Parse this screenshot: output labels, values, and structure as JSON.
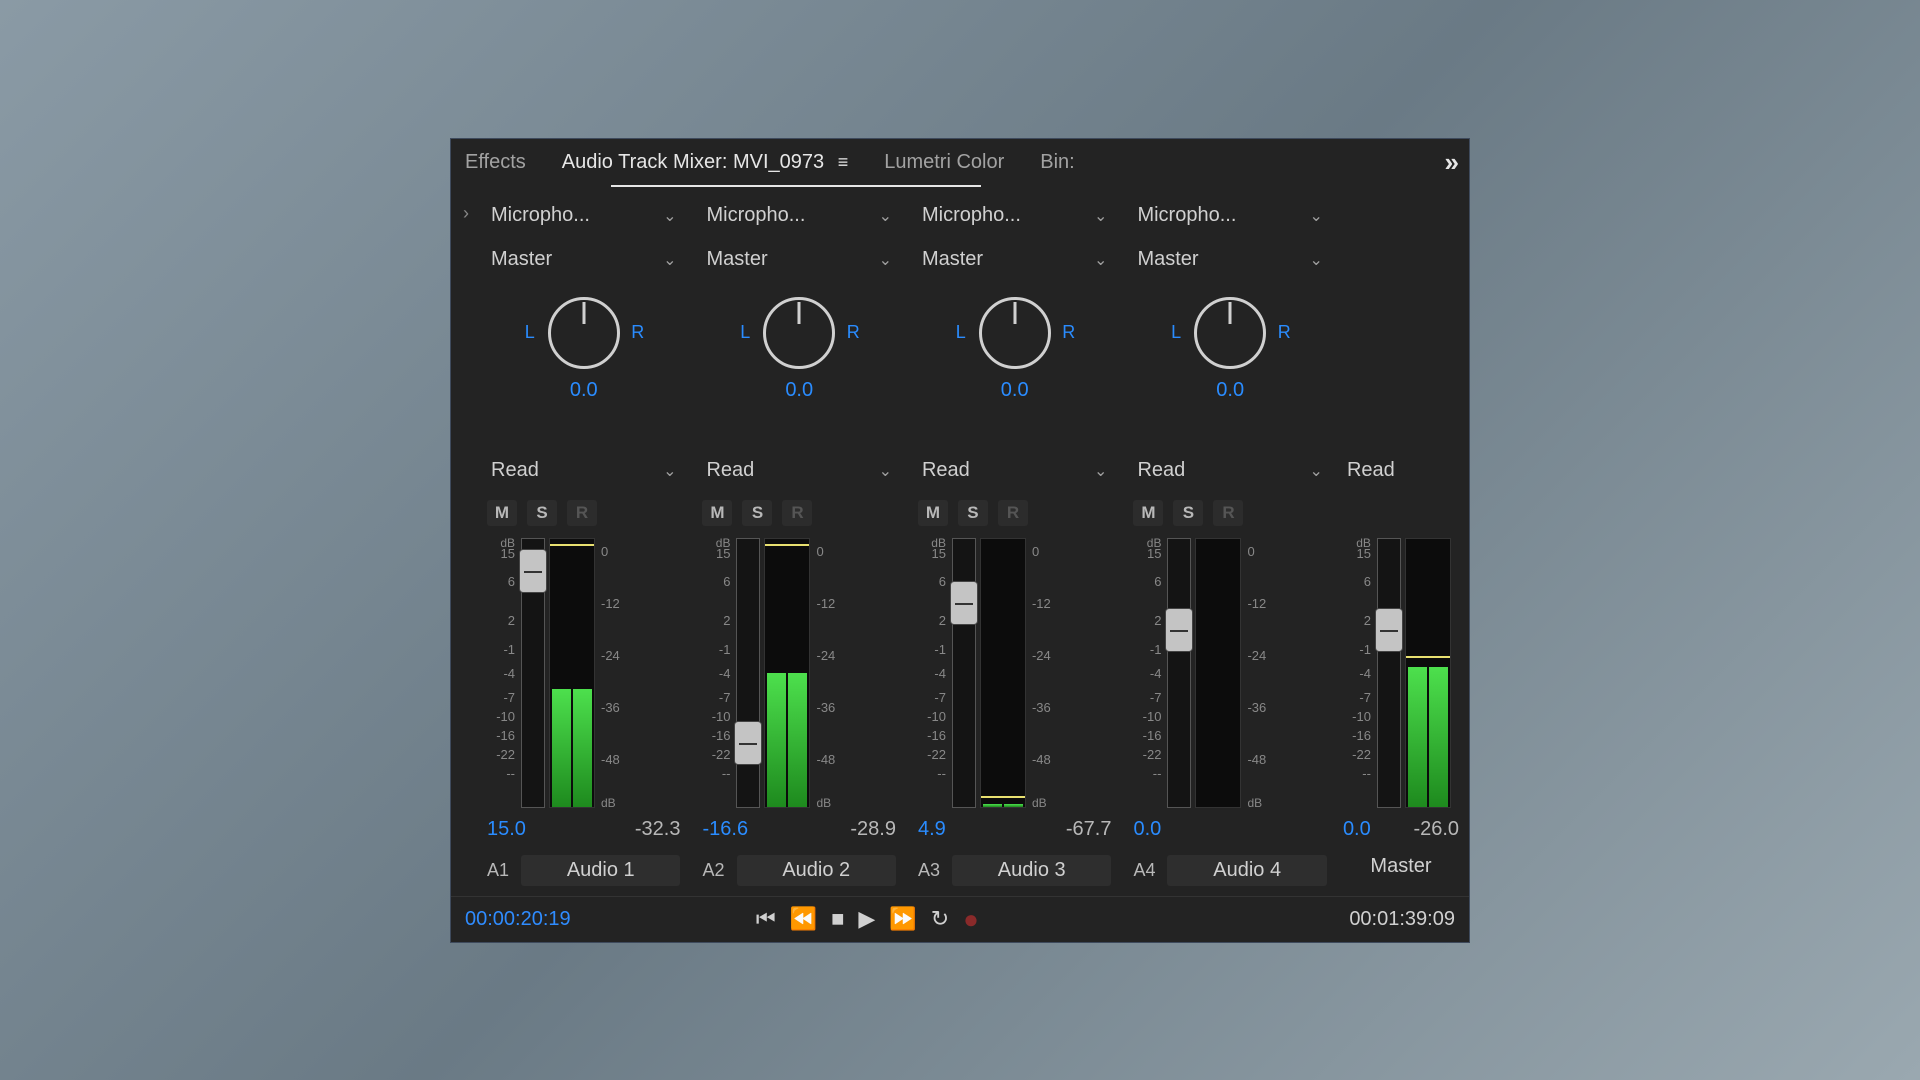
{
  "tabs": {
    "effects": "Effects",
    "mixer": "Audio Track Mixer: MVI_0973",
    "lumetri": "Lumetri Color",
    "bin": "Bin:"
  },
  "pan": {
    "left": "L",
    "right": "R"
  },
  "controls": {
    "mute": "M",
    "solo": "S",
    "record": "R",
    "db_label": "dB"
  },
  "db_scale_left": [
    "15",
    "6",
    "2",
    "-1",
    "-4",
    "-7",
    "-10",
    "-16",
    "-22",
    "--"
  ],
  "db_scale_right": [
    "0",
    "-12",
    "-24",
    "-36",
    "-48"
  ],
  "channels": [
    {
      "id": "A1",
      "name": "Audio 1",
      "input": "Micropho...",
      "output": "Master",
      "mode": "Read",
      "pan": "0.0",
      "volume": "15.0",
      "peak": "-32.3",
      "fader_top_pct": 4,
      "meter_fill_pct": 44,
      "peak_top_pct": 2
    },
    {
      "id": "A2",
      "name": "Audio 2",
      "input": "Micropho...",
      "output": "Master",
      "mode": "Read",
      "pan": "0.0",
      "volume": "-16.6",
      "peak": "-28.9",
      "fader_top_pct": 68,
      "meter_fill_pct": 50,
      "peak_top_pct": 2
    },
    {
      "id": "A3",
      "name": "Audio 3",
      "input": "Micropho...",
      "output": "Master",
      "mode": "Read",
      "pan": "0.0",
      "volume": "4.9",
      "peak": "-67.7",
      "fader_top_pct": 16,
      "meter_fill_pct": 1,
      "peak_top_pct": 96
    },
    {
      "id": "A4",
      "name": "Audio 4",
      "input": "Micropho...",
      "output": "Master",
      "mode": "Read",
      "pan": "0.0",
      "volume": "0.0",
      "peak": "",
      "fader_top_pct": 26,
      "meter_fill_pct": 0,
      "peak_top_pct": -10
    }
  ],
  "master": {
    "name": "Master",
    "mode": "Read",
    "volume": "0.0",
    "peak": "-26.0",
    "fader_top_pct": 26,
    "meter_fill_pct": 52,
    "peak_top_pct": 44
  },
  "transport": {
    "current": "00:00:20:19",
    "total": "00:01:39:09"
  }
}
